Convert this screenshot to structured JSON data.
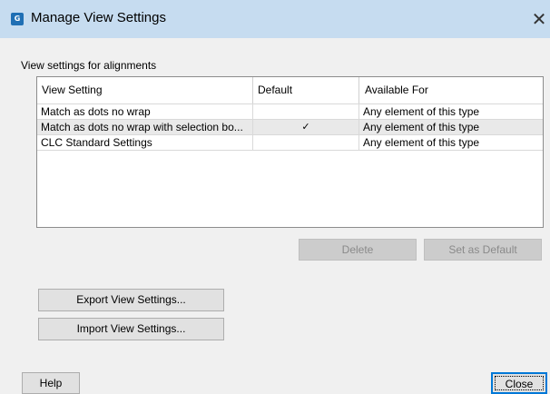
{
  "window": {
    "title": "Manage View Settings",
    "app_icon": "clc-workbench-icon",
    "close_glyph": "✕"
  },
  "section_label": "View settings for alignments",
  "table": {
    "columns": [
      "View Setting",
      "Default",
      "Available For"
    ],
    "rows": [
      {
        "view_setting": "Match as dots no wrap",
        "default": "",
        "available_for": "Any element of this type"
      },
      {
        "view_setting": "Match as dots no wrap with selection bo...",
        "default": "✓",
        "available_for": "Any element of this type"
      },
      {
        "view_setting": "CLC Standard Settings",
        "default": "",
        "available_for": "Any element of this type"
      }
    ],
    "selected_row_index": 1
  },
  "buttons": {
    "delete": "Delete",
    "set_default": "Set as Default",
    "export": "Export View Settings...",
    "import": "Import View Settings...",
    "help": "Help",
    "close": "Close"
  },
  "colors": {
    "titlebar": "#c6dcf0",
    "dialog_bg": "#f0f0f0",
    "selected_row": "#e9e9e9",
    "default_button_border": "#0078d7"
  }
}
